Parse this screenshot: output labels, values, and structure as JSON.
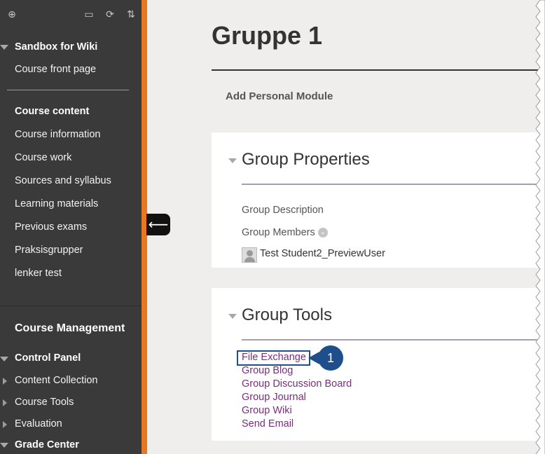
{
  "sidebar": {
    "toolbar": [
      "add-icon",
      "folder-icon",
      "refresh-icon",
      "sort-icon"
    ],
    "course_title": "Sandbox for Wiki",
    "front_page": "Course front page",
    "content_items": [
      "Course content",
      "Course information",
      "Course work",
      "Sources and syllabus",
      "Learning materials",
      "Previous exams",
      "Praksisgrupper",
      "lenker test"
    ],
    "management_title": "Course Management",
    "control_panel": "Control Panel",
    "cp_items": [
      "Content Collection",
      "Course Tools",
      "Evaluation"
    ],
    "grade_center": "Grade Center"
  },
  "main": {
    "title": "Gruppe 1",
    "add_module": "Add Personal Module",
    "properties": {
      "heading": "Group Properties",
      "description_label": "Group Description",
      "members_label": "Group Members",
      "member_name": "Test Student2_PreviewUser"
    },
    "tools": {
      "heading": "Group Tools",
      "links": [
        "File Exchange",
        "Group Blog",
        "Group Discussion Board",
        "Group Journal",
        "Group Wiki",
        "Send Email"
      ]
    },
    "callout_number": "1"
  },
  "colors": {
    "sidebar_bg": "#3a3a3a",
    "accent_orange": "#e87722",
    "link_purple": "#7a2d7c",
    "callout_blue": "#1e4e8c"
  }
}
